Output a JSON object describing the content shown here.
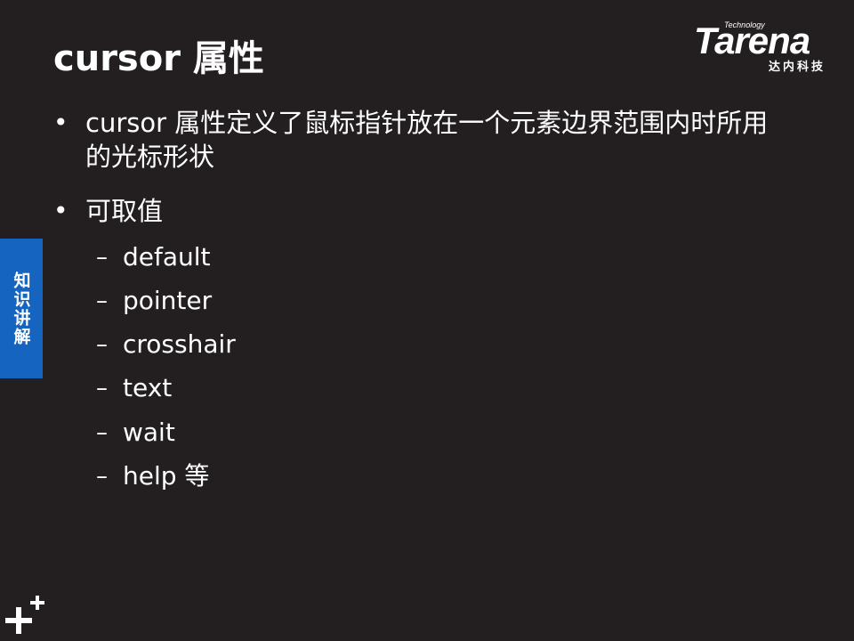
{
  "title": "cursor 属性",
  "logo": {
    "wordmark": "Tarena",
    "tagline": "Technology",
    "subtitle_cn": "达内科技"
  },
  "side_tab": {
    "label": "知识讲解"
  },
  "bullets": [
    {
      "marker": "•",
      "text": "cursor 属性定义了鼠标指针放在一个元素边界范围内时所用的光标形状"
    },
    {
      "marker": "•",
      "text": "可取值"
    }
  ],
  "values": [
    {
      "marker": "–",
      "text": "default"
    },
    {
      "marker": "–",
      "text": "pointer"
    },
    {
      "marker": "–",
      "text": "crosshair"
    },
    {
      "marker": "–",
      "text": "text"
    },
    {
      "marker": "–",
      "text": "wait"
    },
    {
      "marker": "–",
      "text": "help 等"
    }
  ],
  "colors": {
    "background": "#231f20",
    "text": "#ffffff",
    "side_tab": "#1565c0"
  },
  "icons": {
    "bottom_left": "plus-icon"
  }
}
